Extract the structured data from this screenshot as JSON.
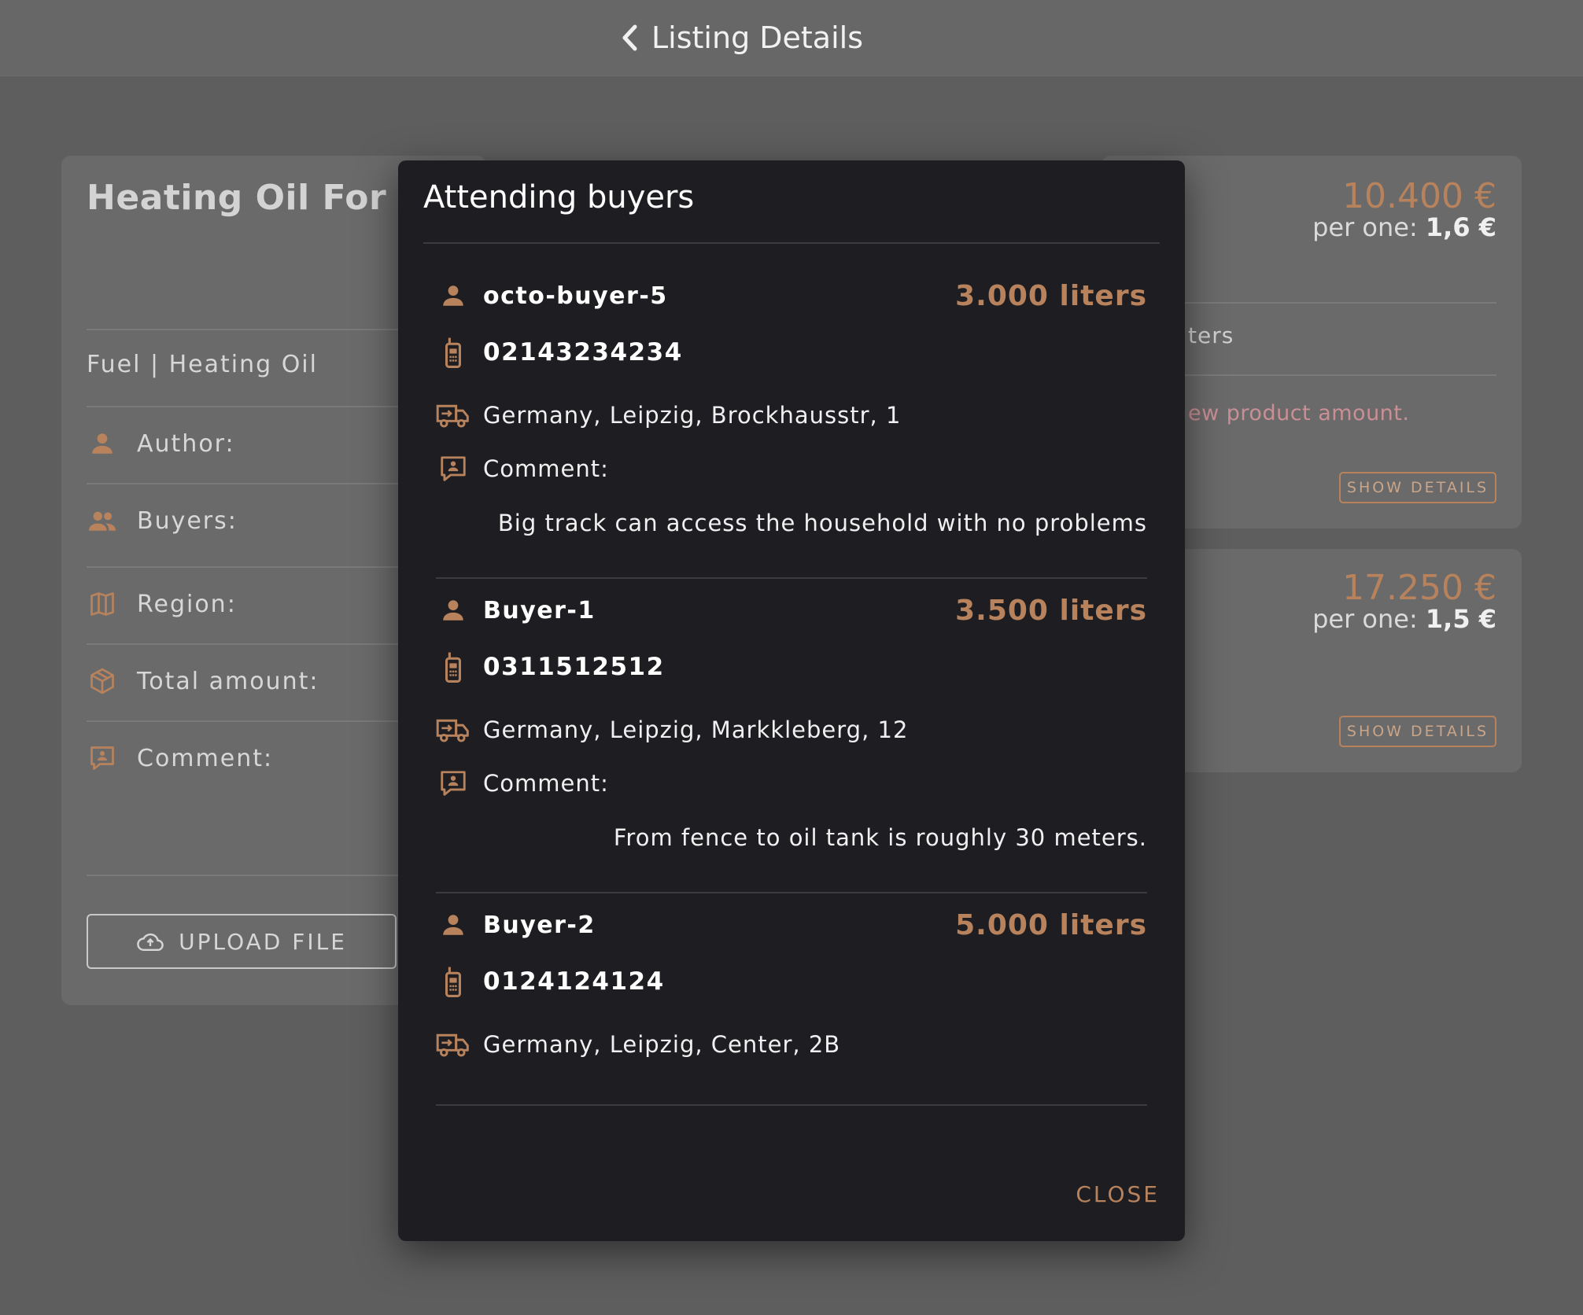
{
  "header": {
    "title": "Listing Details",
    "back_icon": "chevron-left-icon"
  },
  "listing": {
    "title": "Heating Oil For Ho",
    "category": "Fuel | Heating Oil",
    "fields": {
      "author": "Author:",
      "buyers": "Buyers:",
      "region": "Region:",
      "total_amount": "Total amount:",
      "comment": "Comment:"
    },
    "upload_button": "UPLOAD FILE"
  },
  "offers": [
    {
      "price": "10.400 €",
      "per_one_label": "per one: ",
      "per_one_value": "1,6 €",
      "amount_partial": "ters",
      "warning_partial": "ew product amount.",
      "details_button": "SHOW DETAILS"
    },
    {
      "price": "17.250 €",
      "per_one_label": "per one: ",
      "per_one_value": "1,5 €",
      "details_button": "SHOW DETAILS"
    }
  ],
  "modal": {
    "title": "Attending buyers",
    "close_button": "CLOSE",
    "buyers": [
      {
        "name": "octo-buyer-5",
        "amount": "3.000 liters",
        "phone": "02143234234",
        "address": "Germany, Leipzig, Brockhausstr, 1",
        "comment_label": "Comment:",
        "comment": "Big track can access the household with no problems"
      },
      {
        "name": "Buyer-1",
        "amount": "3.500 liters",
        "phone": "0311512512",
        "address": "Germany, Leipzig, Markkleberg, 12",
        "comment_label": "Comment:",
        "comment": "From fence to oil tank is roughly 30 meters."
      },
      {
        "name": "Buyer-2",
        "amount": "5.000 liters",
        "phone": "0124124124",
        "address": "Germany, Leipzig, Center, 2B"
      }
    ]
  },
  "colors": {
    "accent": "#b8835c",
    "modal_bg": "#1e1e22",
    "overlay_bg": "#5e5e5f",
    "warning": "#c98f94"
  }
}
